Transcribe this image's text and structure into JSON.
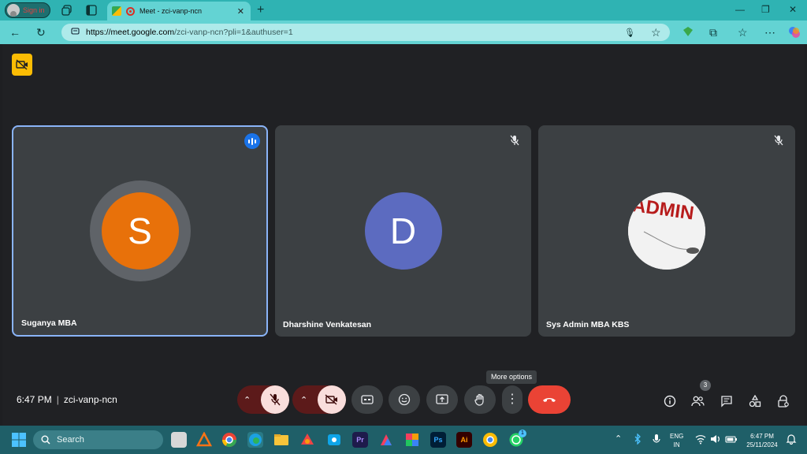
{
  "browser": {
    "signin_label": "Sign in",
    "tab_title": "Meet - zci-vanp-ncn",
    "new_tab": "+",
    "url_host": "https://meet.google.com",
    "url_path": "/zci-vanp-ncn?pli=1&authuser=1"
  },
  "meet": {
    "participants": [
      {
        "name": "Suganya MBA",
        "initial": "S",
        "color": "#e8710a",
        "speaking": true
      },
      {
        "name": "Dharshine Venkatesan",
        "initial": "D",
        "color": "#5c6bc0",
        "muted": true
      },
      {
        "name": "Sys Admin MBA KBS",
        "initial": "",
        "picture": "ADMIN",
        "muted": true
      }
    ],
    "time": "6:47 PM",
    "meeting_code": "zci-vanp-ncn",
    "tooltip": "More options",
    "people_count": "3"
  },
  "taskbar": {
    "search_label": "Search",
    "lang_line1": "ENG",
    "lang_line2": "IN",
    "time": "6:47 PM",
    "date": "25/11/2024",
    "whatsapp_badge": "1"
  }
}
